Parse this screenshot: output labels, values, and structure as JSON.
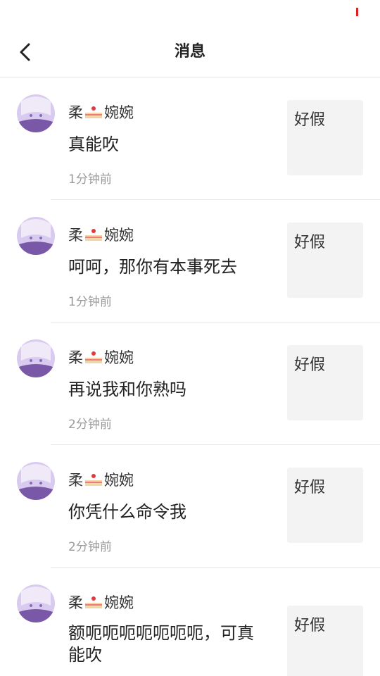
{
  "header": {
    "title": "消息"
  },
  "messages": [
    {
      "sender_pre": "柔",
      "sender_post": "婉婉",
      "text": "真能吹",
      "time": "1分钟前",
      "thumb_text": "好假"
    },
    {
      "sender_pre": "柔",
      "sender_post": "婉婉",
      "text": "呵呵，那你有本事死去",
      "time": "1分钟前",
      "thumb_text": "好假"
    },
    {
      "sender_pre": "柔",
      "sender_post": "婉婉",
      "text": "再说我和你熟吗",
      "time": "2分钟前",
      "thumb_text": "好假"
    },
    {
      "sender_pre": "柔",
      "sender_post": "婉婉",
      "text": "你凭什么命令我",
      "time": "2分钟前",
      "thumb_text": "好假"
    },
    {
      "sender_pre": "柔",
      "sender_post": "婉婉",
      "text": "额呃呃呃呃呃呃呃，可真能吹",
      "time": "",
      "thumb_text": "好假"
    }
  ],
  "icons": {
    "back": "back-arrow-icon",
    "sender_emoji": "cake-icon",
    "avatar": "anime-avatar"
  },
  "colors": {
    "status_mark": "#e02020",
    "divider": "#e8e8e8",
    "time_text": "#9a9a9a",
    "thumb_bg": "#f3f3f3"
  }
}
